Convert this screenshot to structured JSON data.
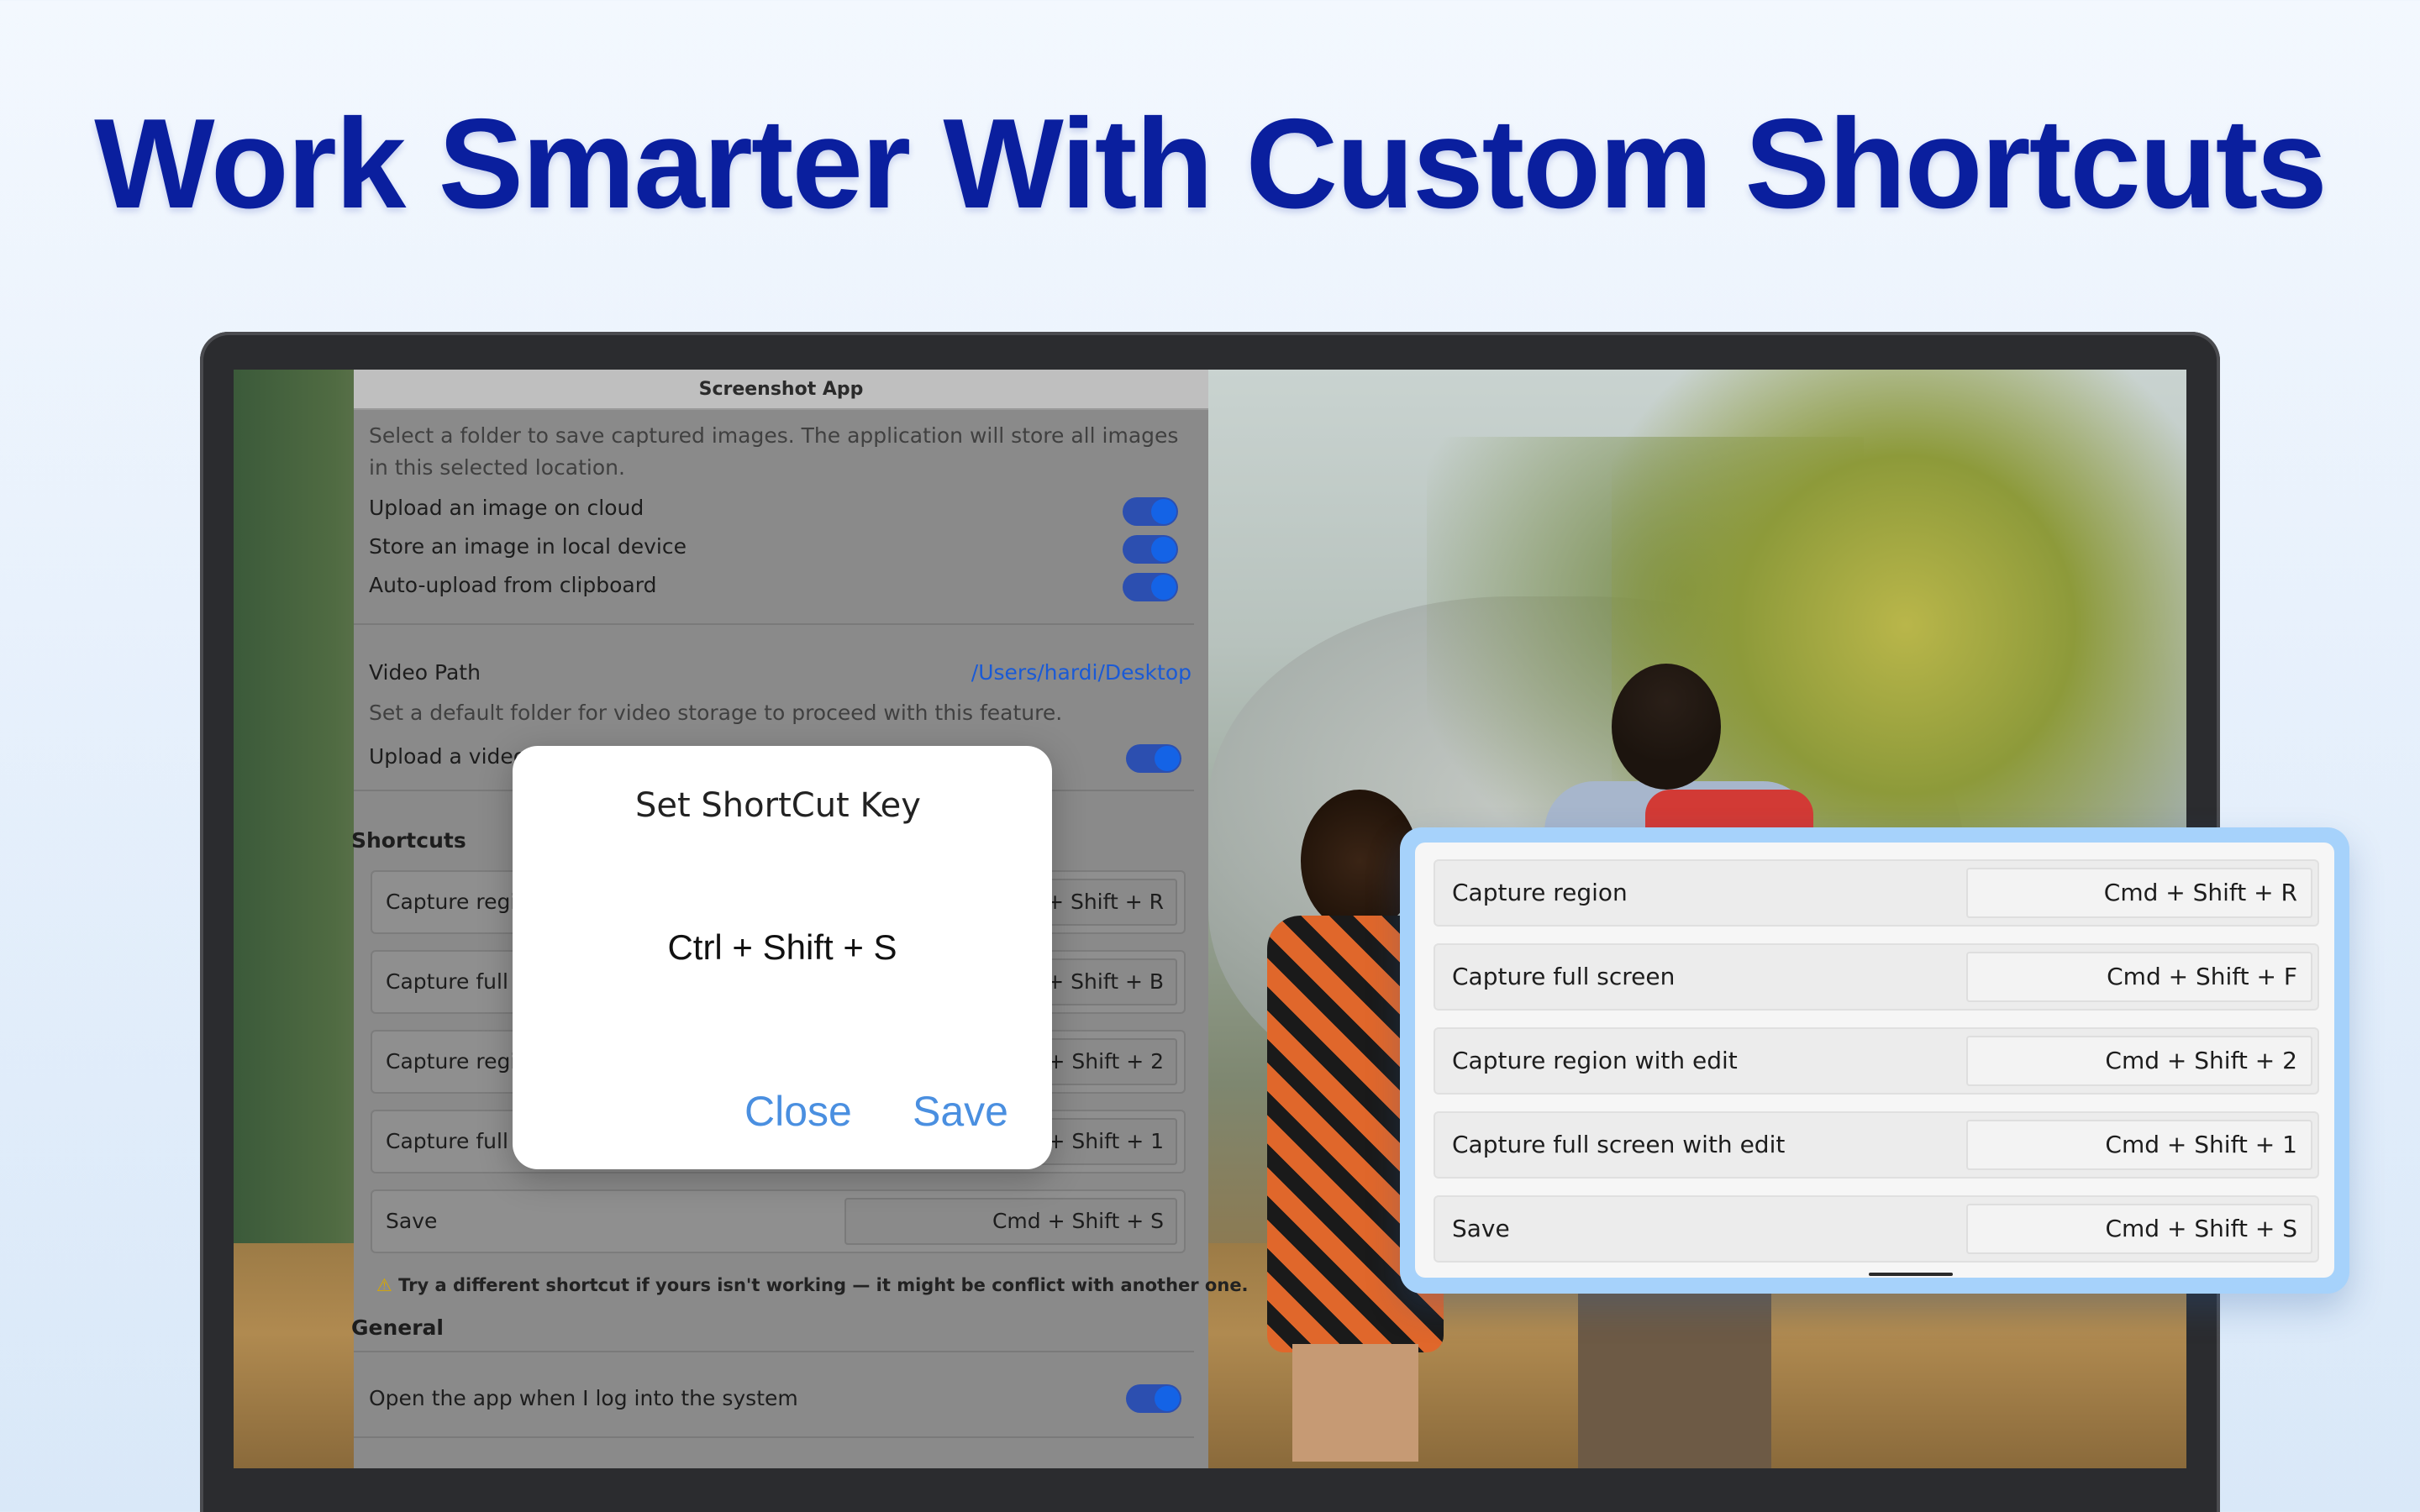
{
  "headline": "Work Smarter With Custom Shortcuts",
  "app": {
    "title": "Screenshot App",
    "image_desc": "Select a folder to save captured images. The application will store all images in this selected location.",
    "toggles": [
      {
        "label": "Upload an image on cloud",
        "on": true
      },
      {
        "label": "Store an image in local device",
        "on": true
      },
      {
        "label": "Auto-upload from clipboard",
        "on": true
      }
    ],
    "video_path_label": "Video Path",
    "video_path_value": "/Users/hardi/Desktop",
    "video_desc": "Set a default folder for video storage to proceed with this feature.",
    "upload_video_label": "Upload a video",
    "shortcuts_heading": "Shortcuts",
    "shortcuts": [
      {
        "label": "Capture region",
        "key": "Cmd + Shift + R"
      },
      {
        "label": "Capture full screen",
        "key": "Cmd + Shift + B"
      },
      {
        "label": "Capture region with edit",
        "key": "Cmd + Shift + 2"
      },
      {
        "label": "Capture full screen with edit",
        "key": "Cmd + Shift + 1"
      },
      {
        "label": "Save",
        "key": "Cmd + Shift + S"
      }
    ],
    "warning": "Try a different shortcut if yours isn't working — it might be conflict with another one.",
    "general_heading": "General",
    "general_toggle_label": "Open the app when I log into the system"
  },
  "modal": {
    "title": "Set ShortCut Key",
    "shortcut": "Ctrl + Shift + S",
    "close_label": "Close",
    "save_label": "Save"
  },
  "card": {
    "rows": [
      {
        "label": "Capture region",
        "key": "Cmd + Shift + R"
      },
      {
        "label": "Capture full screen",
        "key": "Cmd + Shift + F"
      },
      {
        "label": "Capture region with edit",
        "key": "Cmd + Shift + 2"
      },
      {
        "label": "Capture full screen with edit",
        "key": "Cmd + Shift + 1"
      },
      {
        "label": "Save",
        "key": "Cmd + Shift + S"
      }
    ]
  },
  "colors": {
    "headline": "#0a1f9e",
    "toggle_on": "#1463e6",
    "link": "#1a5ad6",
    "modal_button": "#4a8fe0",
    "card_border": "#a6d2fb"
  },
  "icons": {
    "warning": "warning-icon"
  }
}
